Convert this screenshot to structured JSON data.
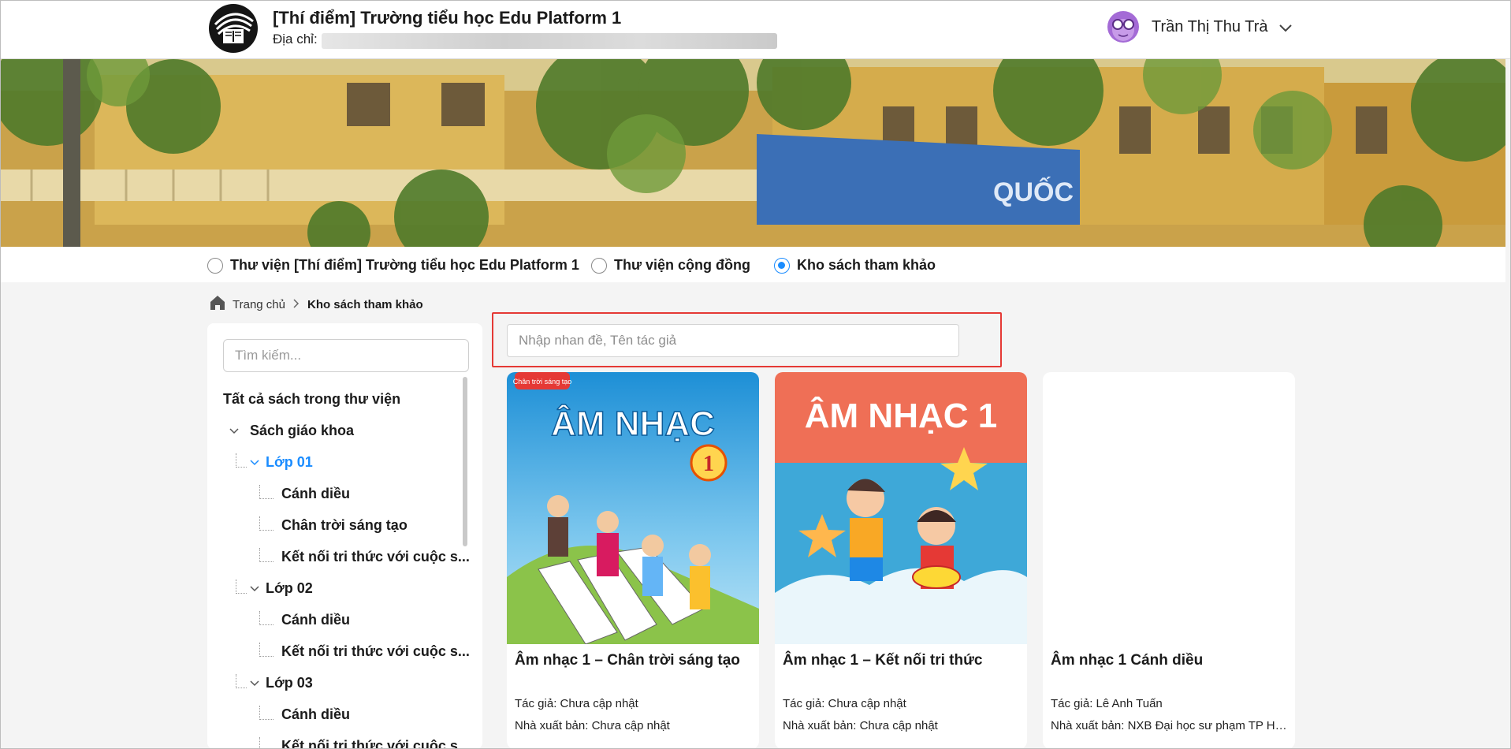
{
  "header": {
    "school_name": "[Thí điểm] Trường tiểu học Edu Platform 1",
    "address_label": "Địa chỉ:",
    "user_name": "Trần Thị Thu Trà"
  },
  "libraries": {
    "items": [
      {
        "label": "Thư viện [Thí điểm] Trường tiểu học Edu Platform 1",
        "selected": false
      },
      {
        "label": "Thư viện cộng đồng",
        "selected": false
      },
      {
        "label": "Kho sách tham khảo",
        "selected": true
      }
    ]
  },
  "breadcrumb": {
    "home": "Trang chủ",
    "current": "Kho sách tham khảo"
  },
  "sidebar": {
    "search_placeholder": "Tìm kiếm...",
    "root": "Tất cả sách trong thư viện",
    "tree": [
      {
        "label": "Sách giáo khoa"
      },
      {
        "label": "Lớp 01"
      },
      {
        "label": "Cánh diều"
      },
      {
        "label": "Chân trời sáng tạo"
      },
      {
        "label": "Kết nối tri thức với cuộc s..."
      },
      {
        "label": "Lớp 02"
      },
      {
        "label": "Cánh diều"
      },
      {
        "label": "Kết nối tri thức với cuộc s..."
      },
      {
        "label": "Lớp 03"
      },
      {
        "label": "Cánh diều"
      },
      {
        "label": "Kết nối tri thức với cuộc s..."
      }
    ]
  },
  "search": {
    "placeholder": "Nhập nhan đề, Tên tác giả"
  },
  "books": [
    {
      "title": "Âm nhạc 1 – Chân trời sáng tạo",
      "author": "Tác giả: Chưa cập nhật",
      "publisher": "Nhà xuất bản: Chưa cập nhật",
      "cover_title": "ÂM NHẠC",
      "cover_number": "1",
      "cover_badge": "Chân trời sáng tạo"
    },
    {
      "title": "Âm nhạc 1 – Kết nối tri thức",
      "author": "Tác giả: Chưa cập nhật",
      "publisher": "Nhà xuất bản: Chưa cập nhật",
      "cover_title": "ÂM NHẠC 1"
    },
    {
      "title": "Âm nhạc 1 Cánh diều",
      "author": "Tác giả: Lê Anh Tuấn",
      "publisher": "Nhà xuất bản: NXB Đại học sư phạm TP Hồ..."
    }
  ],
  "colors": {
    "accent": "#1a8cff",
    "highlight_border": "#e53935"
  }
}
